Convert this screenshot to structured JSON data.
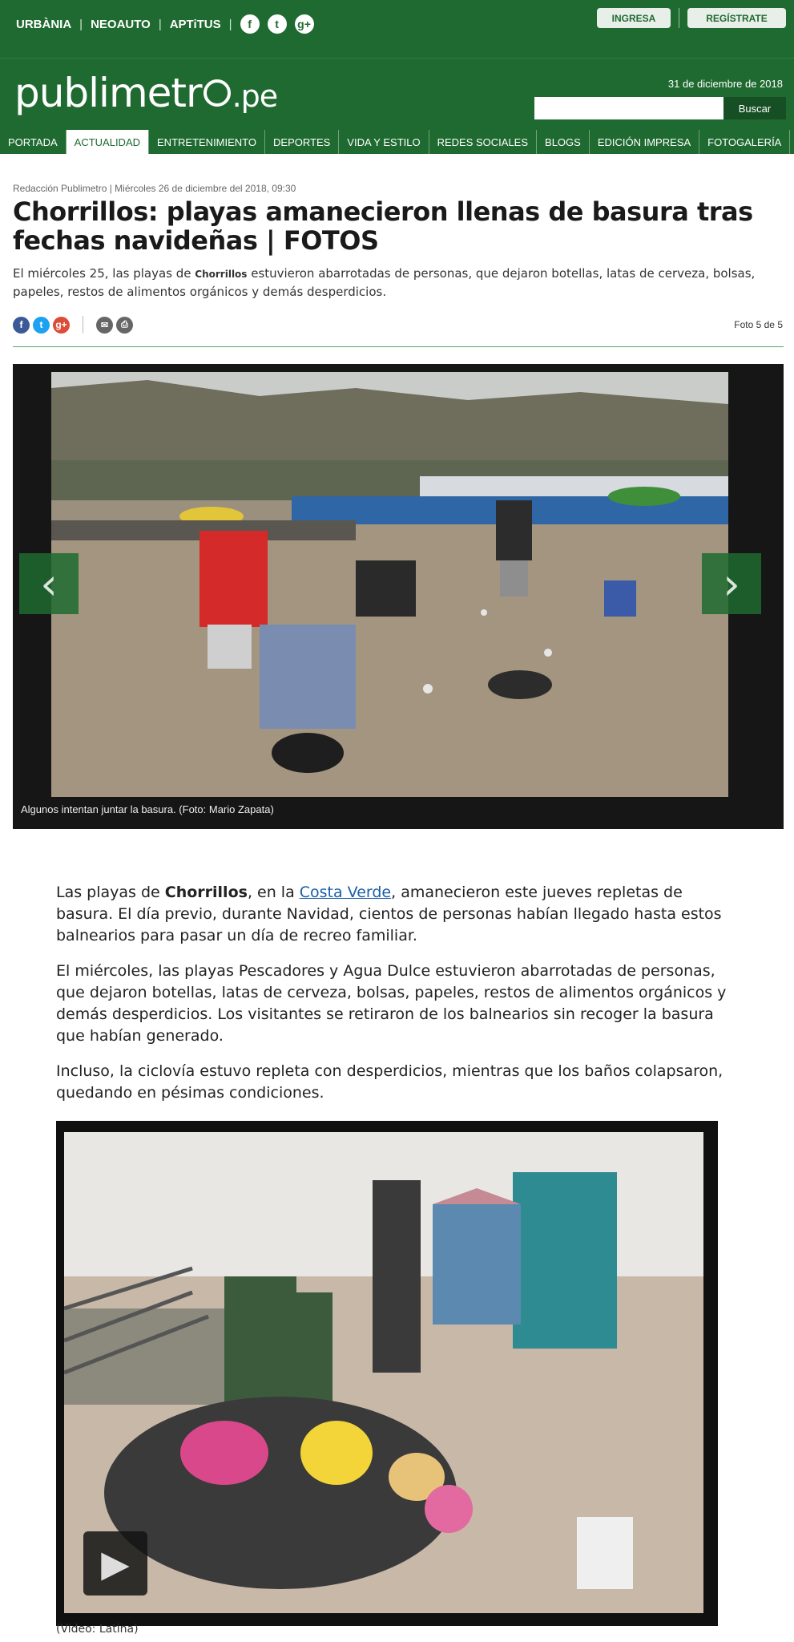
{
  "header": {
    "partners": [
      "URBÀNIA",
      "NEOAUTO",
      "APTiTUS"
    ],
    "social": [
      {
        "icon": "facebook-icon",
        "glyph": "f"
      },
      {
        "icon": "twitter-icon",
        "glyph": "t"
      },
      {
        "icon": "google-plus-icon",
        "glyph": "g+"
      }
    ],
    "login_label": "INGRESA",
    "register_label": "REGÍSTRATE",
    "logo_text": "publimetr",
    "logo_suffix": ".pe",
    "date": "31 de diciembre de 2018",
    "search_placeholder": "",
    "search_button": "Buscar"
  },
  "nav": {
    "items": [
      "PORTADA",
      "ACTUALIDAD",
      "ENTRETENIMIENTO",
      "DEPORTES",
      "VIDA Y ESTILO",
      "REDES SOCIALES",
      "BLOGS",
      "EDICIÓN IMPRESA",
      "FOTOGALERÍA"
    ],
    "active": "ACTUALIDAD"
  },
  "article": {
    "byline": "Redacción Publimetro | Miércoles 26 de diciembre del 2018, 09:30",
    "title": "Chorrillos: playas amanecieron llenas de basura tras fechas navideñas | FOTOS",
    "lead_prefix": "El miércoles 25, las playas de ",
    "lead_small": "Chorrillos",
    "lead_suffix": " estuvieron abarrotadas de personas, que dejaron botellas, latas de cerveza, bolsas, papeles, restos de alimentos orgánicos y demás desperdicios.",
    "photo_counter": "Foto 5 de 5",
    "share": {
      "fb": "f",
      "tw": "t",
      "gp": "g+",
      "mail": "✉",
      "print": "⎙"
    }
  },
  "gallery": {
    "caption": "Algunos intentan juntar la basura. (Foto: Mario Zapata)",
    "prev_glyph": "‹",
    "next_glyph": "›"
  },
  "body": {
    "p1_a": "Las playas de ",
    "p1_bold": "Chorrillos",
    "p1_b": ", en la ",
    "p1_link": "Costa Verde",
    "p1_c": ", amanecieron este jueves repletas de basura. El día previo, durante Navidad, cientos de personas habían llegado hasta estos balnearios para pasar un día de recreo familiar.",
    "p2": "El miércoles, las playas Pescadores y Agua Dulce estuvieron abarrotadas de personas, que dejaron botellas, latas de cerveza, bolsas, papeles, restos de alimentos orgánicos y demás desperdicios. Los visitantes se retiraron de los balnearios sin recoger la basura que habían generado.",
    "p3": "Incluso, la ciclovía estuvo repleta con desperdicios, mientras que los baños colapsaron, quedando en pésimas condiciones."
  },
  "video": {
    "play_glyph": "▶",
    "caption": "(Video: Latina)"
  },
  "colors": {
    "brand_green": "#1f6a30",
    "link_blue": "#1a5ea8"
  }
}
